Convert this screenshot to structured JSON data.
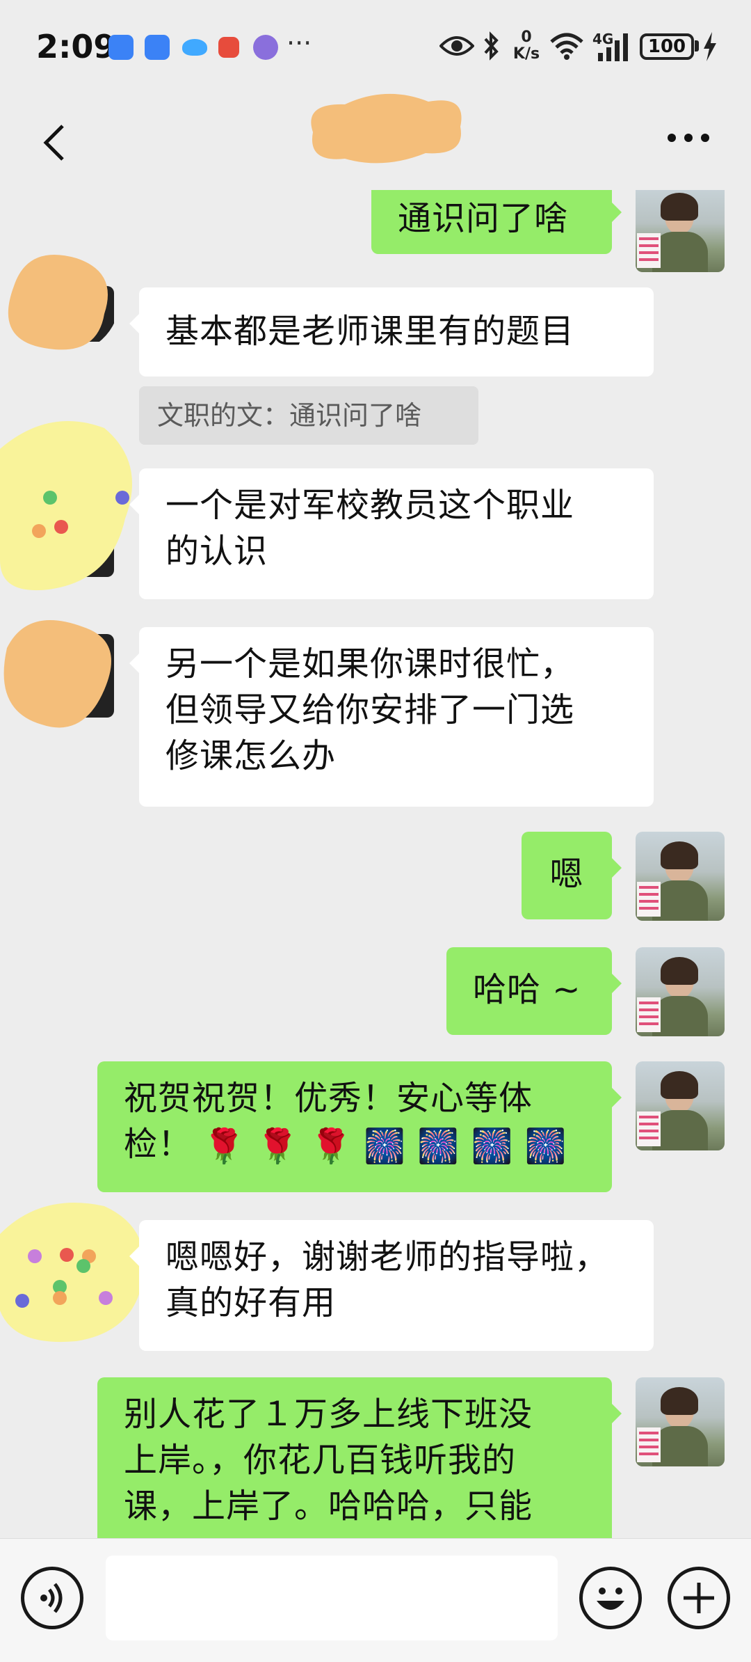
{
  "status_bar": {
    "time": "2:09",
    "dots": "···",
    "speed_value": "0",
    "speed_unit": "K/s",
    "network": "4G",
    "battery": "100"
  },
  "header": {
    "back_icon": "chevron-left-icon",
    "more_icon": "ellipsis-icon"
  },
  "messages": [
    {
      "side": "out",
      "text": "通识问了啥"
    },
    {
      "side": "in",
      "text": "基本都是老师课里有的题目"
    },
    {
      "side": "quote",
      "text": "文职的文：通识问了啥"
    },
    {
      "side": "in",
      "lines": [
        "一个是对军校教员这个职业",
        "的认识"
      ]
    },
    {
      "side": "in",
      "lines": [
        "另一个是如果你课时很忙，",
        "但领导又给你安排了一门选",
        "修课怎么办"
      ]
    },
    {
      "side": "out",
      "text": "嗯"
    },
    {
      "side": "out",
      "text": "哈哈 ~"
    },
    {
      "side": "out",
      "lines": [
        "祝贺祝贺！优秀！安心等体",
        "检！"
      ],
      "emoji": [
        "🌹",
        "🌹",
        "🌹",
        "🎆",
        "🎆",
        "🎆",
        "🎆"
      ]
    },
    {
      "side": "in",
      "lines": [
        "嗯嗯好，谢谢老师的指导啦，",
        "真的好有用"
      ]
    },
    {
      "side": "out",
      "lines": [
        "别人花了１万多上线下班没",
        "上岸。，你花几百钱听我的",
        "课，上岸了。哈哈哈，只能"
      ]
    }
  ],
  "input_bar": {
    "placeholder": "",
    "voice_icon": "voice-icon",
    "emoji_icon": "smiley-icon",
    "plus_icon": "plus-icon"
  },
  "colors": {
    "background": "#ededed",
    "incoming_bubble": "#ffffff",
    "outgoing_bubble": "#95ec69",
    "quote_bg": "#dedede"
  }
}
